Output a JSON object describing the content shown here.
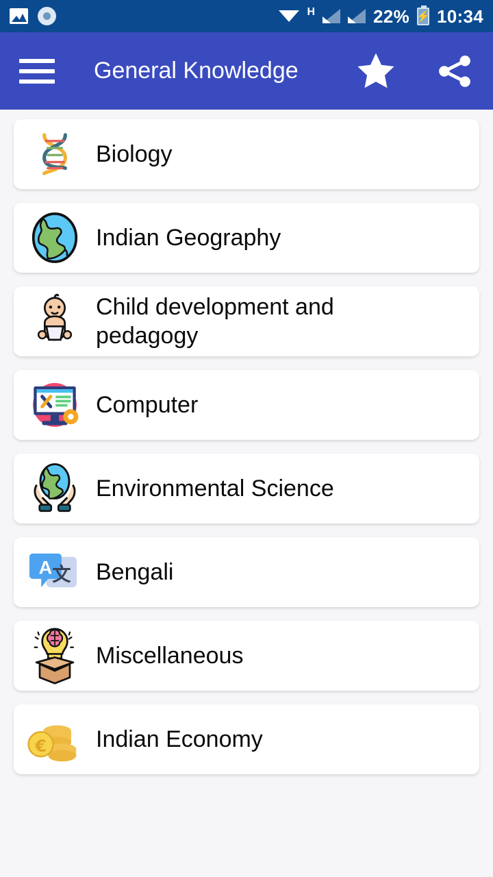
{
  "status_bar": {
    "left_icons": [
      {
        "name": "photo-icon",
        "label": "photo"
      },
      {
        "name": "screen-record-icon",
        "label": "screen recorder"
      }
    ],
    "wifi_icon": "wifi-icon",
    "network_type": "H",
    "signal_icons": [
      "signal-bars-sim1-icon",
      "signal-bars-sim2-icon"
    ],
    "battery_percent": "22%",
    "battery_icon": "battery-charging-icon",
    "clock": "10:34"
  },
  "app_bar": {
    "menu_icon": "hamburger-menu-icon",
    "title": "General Knowledge",
    "favorite_icon": "star-icon",
    "share_icon": "share-icon",
    "background_color": "#3a4bbf"
  },
  "theme": {
    "status_bar_color": "#0b4a8f",
    "app_bar_color": "#3a4bbf",
    "page_background": "#f6f6f8",
    "card_background": "#ffffff",
    "text_color": "#0a0a0a"
  },
  "list": {
    "items": [
      {
        "label": "Biology",
        "icon": "dna-icon"
      },
      {
        "label": "Indian Geography",
        "icon": "globe-icon"
      },
      {
        "label": "Child development and pedagogy",
        "icon": "baby-icon"
      },
      {
        "label": "Computer",
        "icon": "computer-repair-icon"
      },
      {
        "label": "Environmental Science",
        "icon": "earth-in-hands-icon"
      },
      {
        "label": "Bengali",
        "icon": "translate-icon"
      },
      {
        "label": "Miscellaneous",
        "icon": "brain-lightbulb-box-icon"
      },
      {
        "label": "Indian Economy",
        "icon": "coins-icon"
      }
    ]
  }
}
